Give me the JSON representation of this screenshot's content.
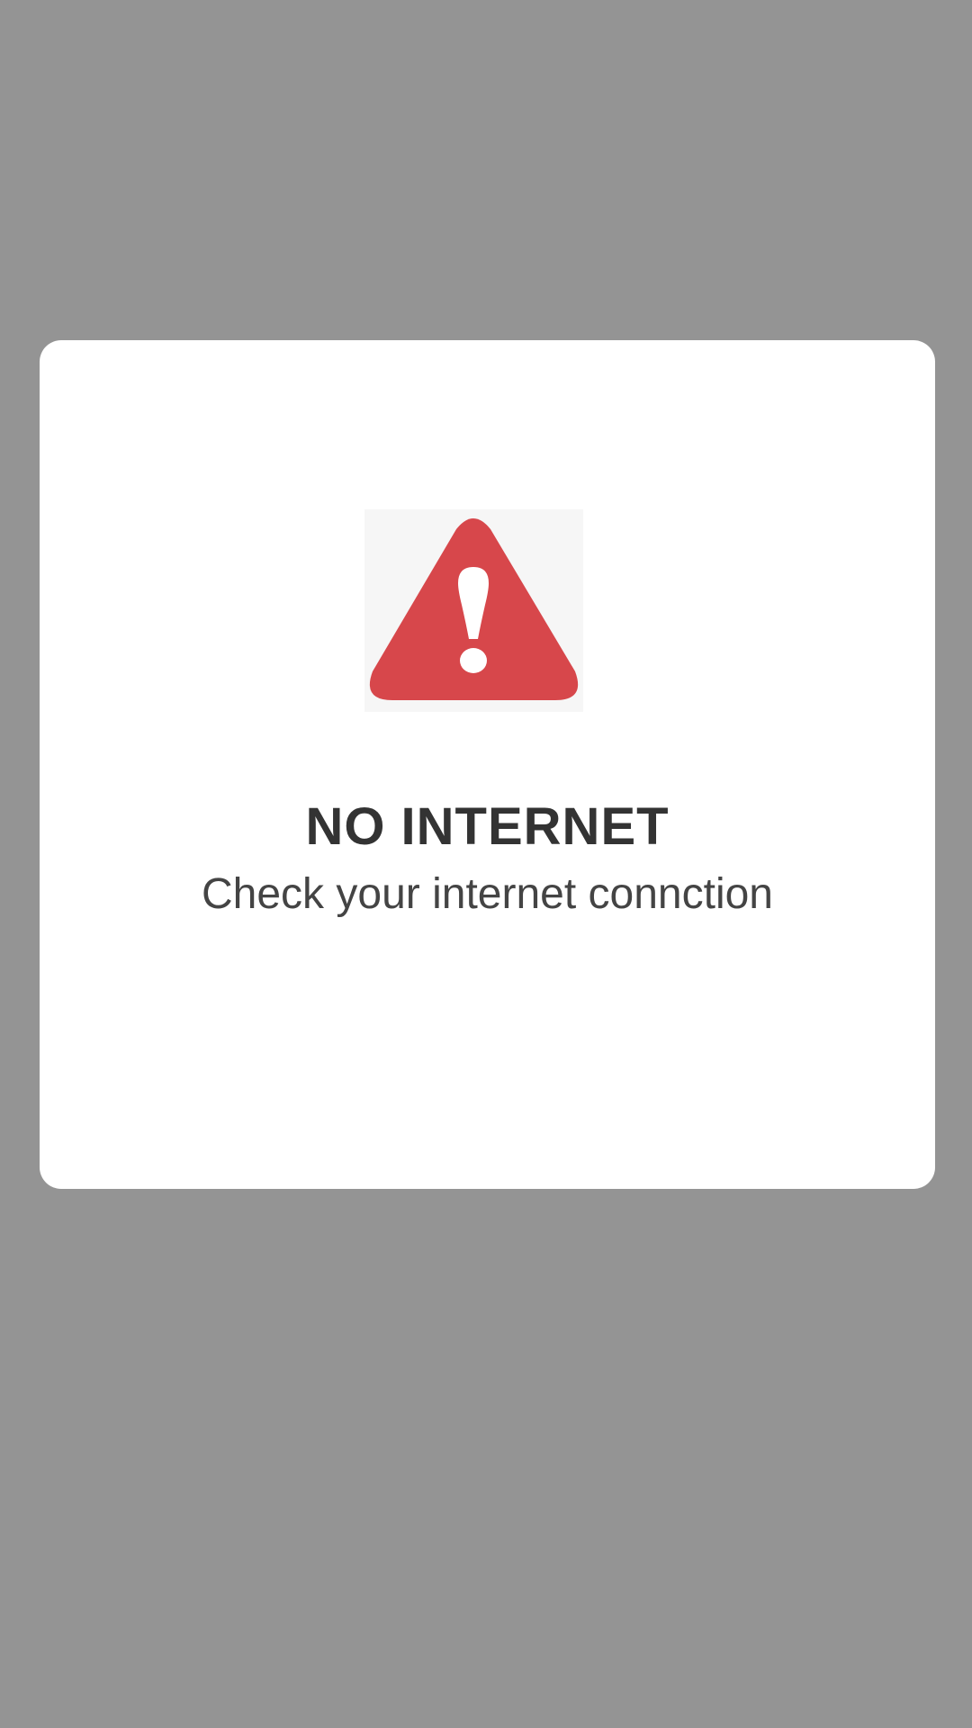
{
  "dialog": {
    "icon": "warning-triangle-icon",
    "title": "NO INTERNET",
    "message": "Check your internet connction"
  },
  "colors": {
    "backdrop": "#949494",
    "dialog_background": "#ffffff",
    "icon_box_background": "#f6f6f6",
    "warning_red": "#d7474b",
    "title_text": "#333333",
    "message_text": "#444444"
  }
}
